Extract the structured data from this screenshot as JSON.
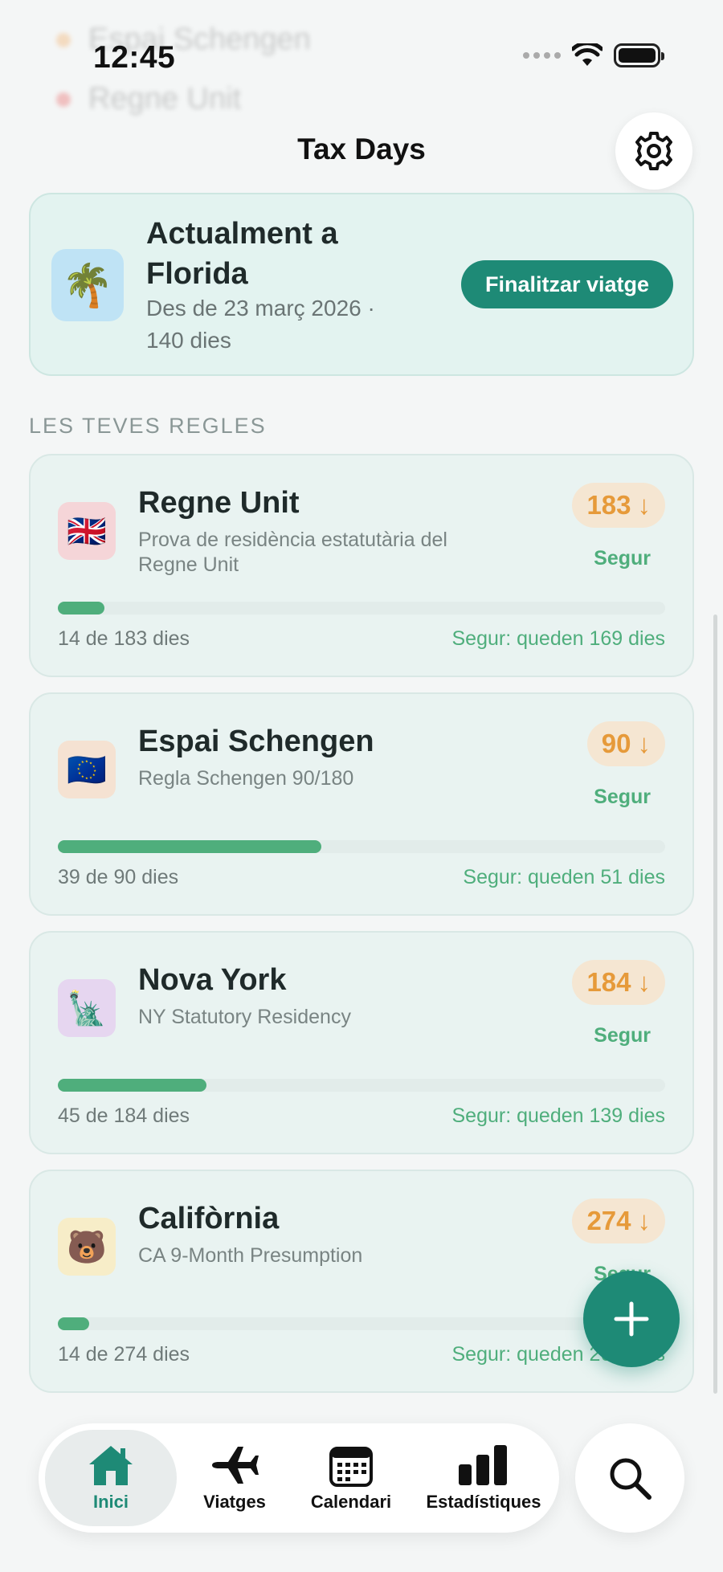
{
  "status_bar": {
    "time": "12:45"
  },
  "background_rows": [
    {
      "label": "Espai Schengen",
      "value": "",
      "color": "#f2a85c"
    },
    {
      "label": "Regne Unit",
      "value": "",
      "color": "#e85a5a"
    }
  ],
  "header": {
    "title": "Tax Days"
  },
  "current_trip": {
    "title": "Actualment a Florida",
    "subtitle": "Des de 23 març 2026 · 140 dies",
    "icon": "palm-tree-icon",
    "end_button": "Finalitzar viatge"
  },
  "section_label": "LES TEVES REGLES",
  "rules": [
    {
      "name": "Regne Unit",
      "description": "Prova de residència estatutària del Regne Unit",
      "flag": "🇬🇧",
      "flag_bg": "#f5d5d8",
      "limit": "183",
      "status": "Segur",
      "count_text": "14 de 183 dies",
      "remaining_text": "Segur: queden 169 dies",
      "progress": 0.0765
    },
    {
      "name": "Espai Schengen",
      "description": "Regla Schengen 90/180",
      "flag": "🇪🇺",
      "flag_bg": "#f5e2d2",
      "limit": "90",
      "status": "Segur",
      "count_text": "39 de 90 dies",
      "remaining_text": "Segur: queden 51 dies",
      "progress": 0.4333
    },
    {
      "name": "Nova York",
      "description": "NY Statutory Residency",
      "flag": "🗽",
      "flag_bg": "#e6d6f0",
      "limit": "184",
      "status": "Segur",
      "count_text": "45 de 184 dies",
      "remaining_text": "Segur: queden 139 dies",
      "progress": 0.2446
    },
    {
      "name": "Califòrnia",
      "description": "CA 9-Month Presumption",
      "flag": "🐻",
      "flag_bg": "#f7edc8",
      "limit": "274",
      "status": "Segur",
      "count_text": "14 de 274 dies",
      "remaining_text": "Segur: queden 260 dies",
      "progress": 0.0511
    }
  ],
  "tabs": [
    {
      "label": "Inici",
      "icon": "house-icon"
    },
    {
      "label": "Viatges",
      "icon": "airplane-icon"
    },
    {
      "label": "Calendari",
      "icon": "calendar-icon"
    },
    {
      "label": "Estadístiques",
      "icon": "bar-chart-icon"
    }
  ],
  "colors": {
    "accent": "#1e8a76",
    "safe": "#4fae7c",
    "badge_text": "#e69a3a"
  }
}
